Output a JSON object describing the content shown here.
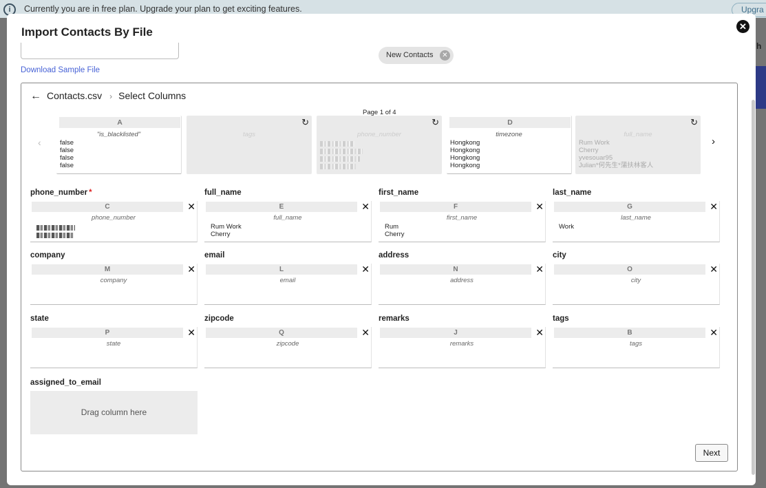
{
  "banner": {
    "text": "Currently you are in free plan. Upgrade your plan to get exciting features.",
    "upgrade_label": "Upgra",
    "info_icon": "i"
  },
  "backdrop": {
    "partial_text": "h"
  },
  "modal": {
    "title": "Import Contacts By File",
    "close_glyph": "✕",
    "download_link": "Download Sample File",
    "chip_label": "New Contacts",
    "chip_close": "✕"
  },
  "breadcrumb": {
    "back_icon": "←",
    "file": "Contacts.csv",
    "separator": "›",
    "step": "Select Columns"
  },
  "pagination": {
    "text": "Page 1 of 4",
    "prev_icon": "‹",
    "next_icon": "›"
  },
  "source_columns": [
    {
      "letter": "A",
      "header": "\"is_blacklisted\"",
      "values": [
        "false",
        "false",
        "false",
        "false"
      ],
      "used": false
    },
    {
      "letter": "",
      "header": "tags",
      "values": [],
      "used": true
    },
    {
      "letter": "",
      "header": "phone_number",
      "values": [],
      "used": true
    },
    {
      "letter": "D",
      "header": "timezone",
      "values": [
        "Hongkong",
        "Hongkong",
        "Hongkong",
        "Hongkong"
      ],
      "used": false
    },
    {
      "letter": "",
      "header": "full_name",
      "values": [
        "Rum Work",
        "Cherry",
        "yvesouar95",
        "Julian*何先生*蒲扶林客人"
      ],
      "used": true
    }
  ],
  "reset_icon": "↻",
  "remove_icon": "✕",
  "fields": [
    {
      "label": "phone_number",
      "required": true,
      "letter": "C",
      "header": "phone_number",
      "values": []
    },
    {
      "label": "full_name",
      "required": false,
      "letter": "E",
      "header": "full_name",
      "values": [
        "Rum Work",
        "Cherry"
      ]
    },
    {
      "label": "first_name",
      "required": false,
      "letter": "F",
      "header": "first_name",
      "values": [
        "Rum",
        "Cherry"
      ]
    },
    {
      "label": "last_name",
      "required": false,
      "letter": "G",
      "header": "last_name",
      "values": [
        "Work"
      ]
    },
    {
      "label": "company",
      "required": false,
      "letter": "M",
      "header": "company",
      "values": []
    },
    {
      "label": "email",
      "required": false,
      "letter": "L",
      "header": "email",
      "values": []
    },
    {
      "label": "address",
      "required": false,
      "letter": "N",
      "header": "address",
      "values": []
    },
    {
      "label": "city",
      "required": false,
      "letter": "O",
      "header": "city",
      "values": []
    },
    {
      "label": "state",
      "required": false,
      "letter": "P",
      "header": "state",
      "values": []
    },
    {
      "label": "zipcode",
      "required": false,
      "letter": "Q",
      "header": "zipcode",
      "values": []
    },
    {
      "label": "remarks",
      "required": false,
      "letter": "J",
      "header": "remarks",
      "values": []
    },
    {
      "label": "tags",
      "required": false,
      "letter": "B",
      "header": "tags",
      "values": []
    }
  ],
  "assigned_field": {
    "label": "assigned_to_email",
    "dropzone_text": "Drag column here"
  },
  "next_label": "Next"
}
